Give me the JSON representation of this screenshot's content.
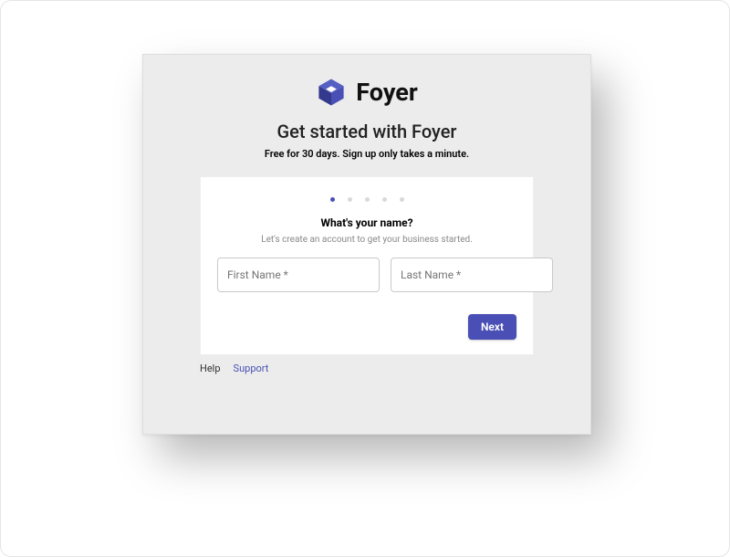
{
  "brand": {
    "name": "Foyer",
    "colors": {
      "primary": "#4a4fb5",
      "primaryDark": "#373e8f",
      "primaryLight": "#6a73d6"
    }
  },
  "header": {
    "title": "Get started with Foyer",
    "subtitle": "Free for 30 days. Sign up only takes a minute."
  },
  "wizard": {
    "steps_total": 5,
    "current_step": 1,
    "question": "What's your name?",
    "question_sub": "Let's create an account to get your business started.",
    "fields": {
      "first_name": {
        "placeholder": "First Name *",
        "value": ""
      },
      "last_name": {
        "placeholder": "Last Name *",
        "value": ""
      }
    },
    "next_label": "Next"
  },
  "footer": {
    "help": "Help",
    "support": "Support"
  }
}
